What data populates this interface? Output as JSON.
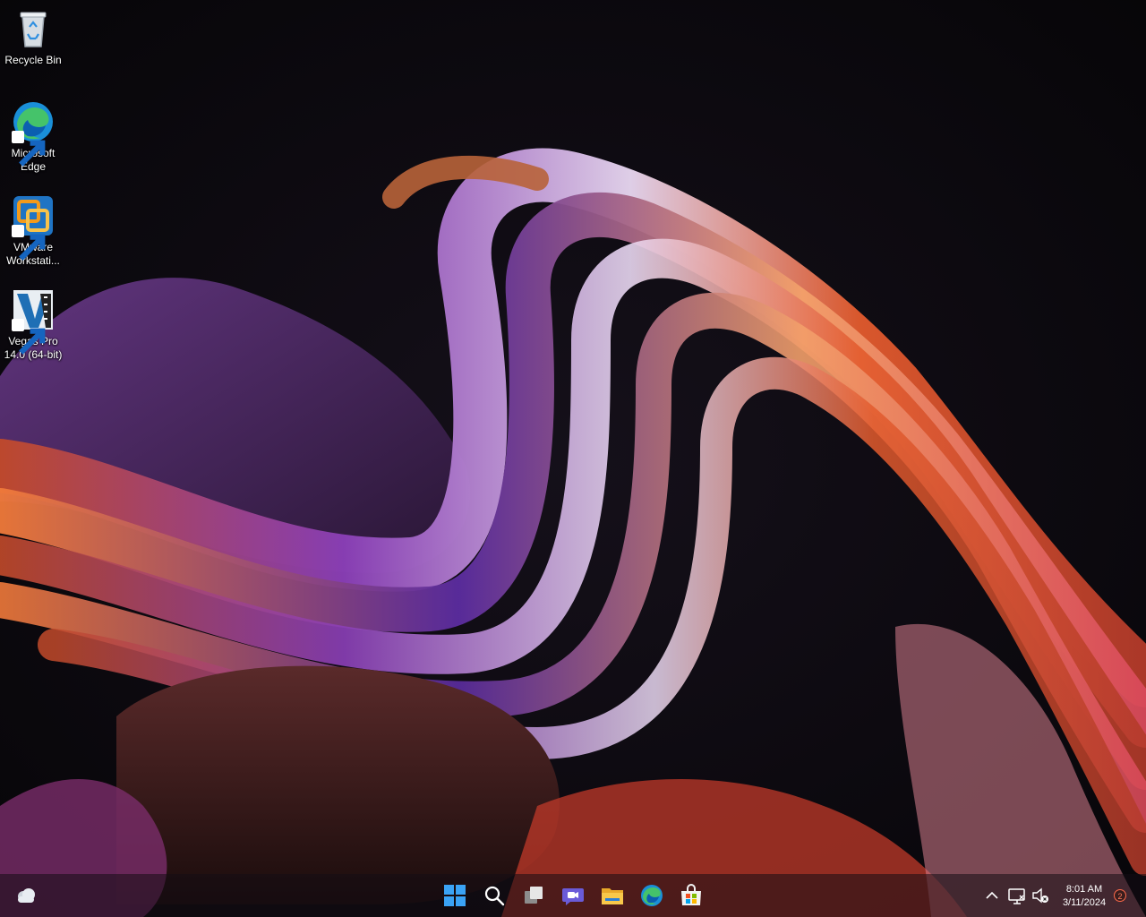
{
  "desktop": {
    "icons": [
      {
        "label": "Recycle Bin",
        "icon": "recycle-bin-icon"
      },
      {
        "label": "Microsoft Edge",
        "icon": "edge-icon"
      },
      {
        "label": "VMware Workstati...",
        "icon": "vmware-icon"
      },
      {
        "label": "Vegas Pro 14.0 (64-bit)",
        "icon": "vegas-pro-icon"
      }
    ]
  },
  "taskbar": {
    "widgets_icon": "weather-cloud-icon",
    "pinned": [
      {
        "name": "Start",
        "icon": "windows-start-icon"
      },
      {
        "name": "Search",
        "icon": "search-icon"
      },
      {
        "name": "Task View",
        "icon": "task-view-icon"
      },
      {
        "name": "Chat",
        "icon": "chat-icon"
      },
      {
        "name": "File Explorer",
        "icon": "file-explorer-icon"
      },
      {
        "name": "Microsoft Edge",
        "icon": "edge-icon"
      },
      {
        "name": "Microsoft Store",
        "icon": "store-icon"
      }
    ],
    "tray": {
      "chevron_icon": "chevron-up-icon",
      "network_icon": "network-icon",
      "volume_icon": "volume-muted-icon",
      "time": "8:01 AM",
      "date": "3/11/2024",
      "notification_count": "2"
    }
  },
  "colors": {
    "accent_orange": "#e2552a",
    "accent_purple": "#6a2fb0",
    "start_blue": "#3aa3f5"
  }
}
